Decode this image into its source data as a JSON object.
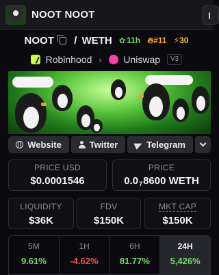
{
  "header": {
    "title": "NOOT NOOT"
  },
  "pair": {
    "base": "NOOT",
    "separator": "/",
    "quote": "WETH",
    "age": "11h",
    "rank": "#11",
    "boosts": "30"
  },
  "venue": {
    "chain": "Robinhood",
    "dex": "Uniswap",
    "version": "V3"
  },
  "links": {
    "website": "Website",
    "twitter": "Twitter",
    "telegram": "Telegram"
  },
  "prices": {
    "usd_label": "PRICE USD",
    "usd_value": "$0.0001546",
    "native_label": "PRICE",
    "native_prefix": "0.0",
    "native_zeros": "7",
    "native_rest": "8600 WETH"
  },
  "stats": {
    "liquidity_label": "LIQUIDITY",
    "liquidity_value": "$36K",
    "fdv_label": "FDV",
    "fdv_value": "$150K",
    "mcap_label": "MKT CAP",
    "mcap_value": "$150K"
  },
  "timeframes": [
    {
      "label": "5M",
      "value": "9.61%",
      "trend": "up"
    },
    {
      "label": "1H",
      "value": "-4.62%",
      "trend": "down"
    },
    {
      "label": "6H",
      "value": "81.77%",
      "trend": "up"
    },
    {
      "label": "24H",
      "value": "5,426%",
      "trend": "up",
      "active": true
    }
  ],
  "colors": {
    "positive": "#74d86a",
    "negative": "#ef5350",
    "rank": "#f0a33a",
    "boost": "#f2c53d"
  }
}
